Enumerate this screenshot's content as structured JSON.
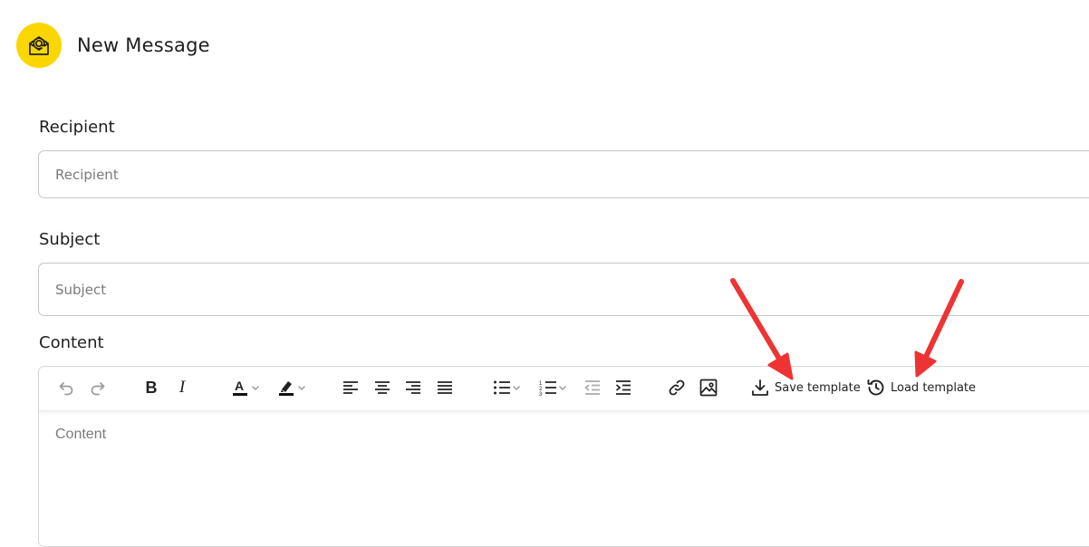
{
  "header": {
    "title": "New Message",
    "icon": "mail-open-icon",
    "icon_bg": "#fcd600"
  },
  "form": {
    "recipient": {
      "label": "Recipient",
      "placeholder": "Recipient",
      "value": ""
    },
    "subject": {
      "label": "Subject",
      "placeholder": "Subject",
      "value": ""
    },
    "content": {
      "label": "Content",
      "placeholder": "Content"
    }
  },
  "toolbar": {
    "save_template": "Save template",
    "load_template": "Load template",
    "buttons": [
      "undo",
      "redo",
      "bold",
      "italic",
      "text-color",
      "highlight",
      "align-left",
      "align-center",
      "align-right",
      "align-justify",
      "bullet-list",
      "numbered-list",
      "outdent",
      "indent",
      "link",
      "image"
    ]
  },
  "annotations": {
    "arrow_color": "#ee3333",
    "targets": [
      "save-template-button",
      "load-template-button"
    ]
  }
}
